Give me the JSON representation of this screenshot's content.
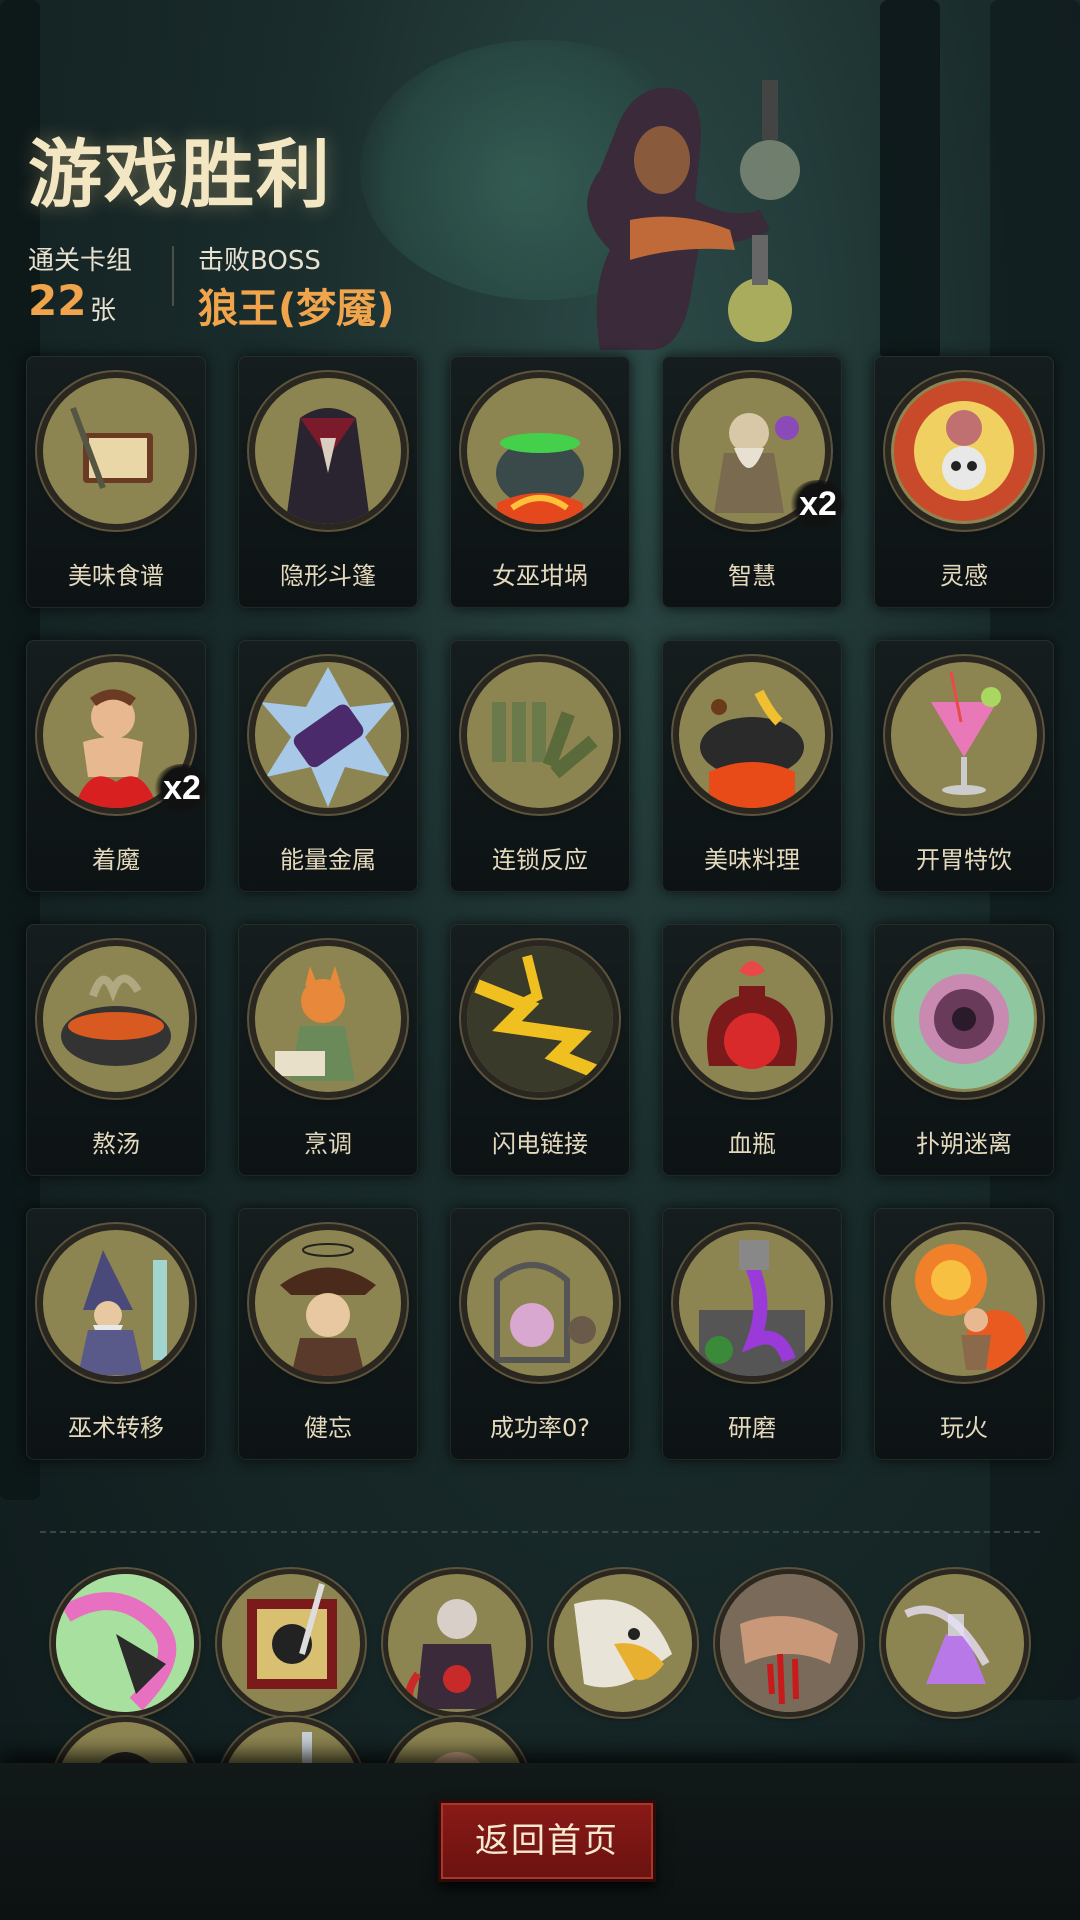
{
  "header": {
    "title": "游戏胜利",
    "deck_label": "通关卡组",
    "deck_count": "22",
    "deck_unit": "张",
    "boss_label": "击败BOSS",
    "boss_name": "狼王(梦魇)"
  },
  "cards": [
    {
      "label": "美味食谱",
      "icon": "recipe-book-icon",
      "mult": ""
    },
    {
      "label": "隐形斗篷",
      "icon": "cloak-icon",
      "mult": ""
    },
    {
      "label": "女巫坩埚",
      "icon": "cauldron-icon",
      "mult": ""
    },
    {
      "label": "智慧",
      "icon": "sage-icon",
      "mult": "x2"
    },
    {
      "label": "灵感",
      "icon": "skull-brain-icon",
      "mult": ""
    },
    {
      "label": "着魔",
      "icon": "possessed-icon",
      "mult": "x2"
    },
    {
      "label": "能量金属",
      "icon": "energy-metal-icon",
      "mult": ""
    },
    {
      "label": "连锁反应",
      "icon": "dominoes-icon",
      "mult": ""
    },
    {
      "label": "美味料理",
      "icon": "wok-icon",
      "mult": ""
    },
    {
      "label": "开胃特饮",
      "icon": "cocktail-icon",
      "mult": ""
    },
    {
      "label": "熬汤",
      "icon": "soup-pot-icon",
      "mult": ""
    },
    {
      "label": "烹调",
      "icon": "fox-chef-icon",
      "mult": ""
    },
    {
      "label": "闪电链接",
      "icon": "lightning-icon",
      "mult": ""
    },
    {
      "label": "血瓶",
      "icon": "blood-potion-icon",
      "mult": ""
    },
    {
      "label": "扑朔迷离",
      "icon": "vortex-icon",
      "mult": ""
    },
    {
      "label": "巫术转移",
      "icon": "wizard-icon",
      "mult": ""
    },
    {
      "label": "健忘",
      "icon": "confused-pirate-icon",
      "mult": ""
    },
    {
      "label": "成功率0?",
      "icon": "caged-creature-icon",
      "mult": ""
    },
    {
      "label": "研磨",
      "icon": "grinder-icon",
      "mult": ""
    },
    {
      "label": "玩火",
      "icon": "fire-fighter-icon",
      "mult": ""
    }
  ],
  "relics": [
    {
      "icon": "chaos-relic-icon"
    },
    {
      "icon": "pirate-flag-icon"
    },
    {
      "icon": "vampire-icon"
    },
    {
      "icon": "eagle-icon"
    },
    {
      "icon": "bleeding-arm-icon"
    },
    {
      "icon": "purple-potion-icon"
    },
    {
      "icon": "vampire-face-icon"
    },
    {
      "icon": "sword-jar-icon"
    },
    {
      "icon": "brute-icon"
    }
  ],
  "footer": {
    "home_label": "返回首页"
  },
  "colors": {
    "accent": "#f0a44b",
    "button": "#8a1a17",
    "medal": "#8d8551"
  }
}
